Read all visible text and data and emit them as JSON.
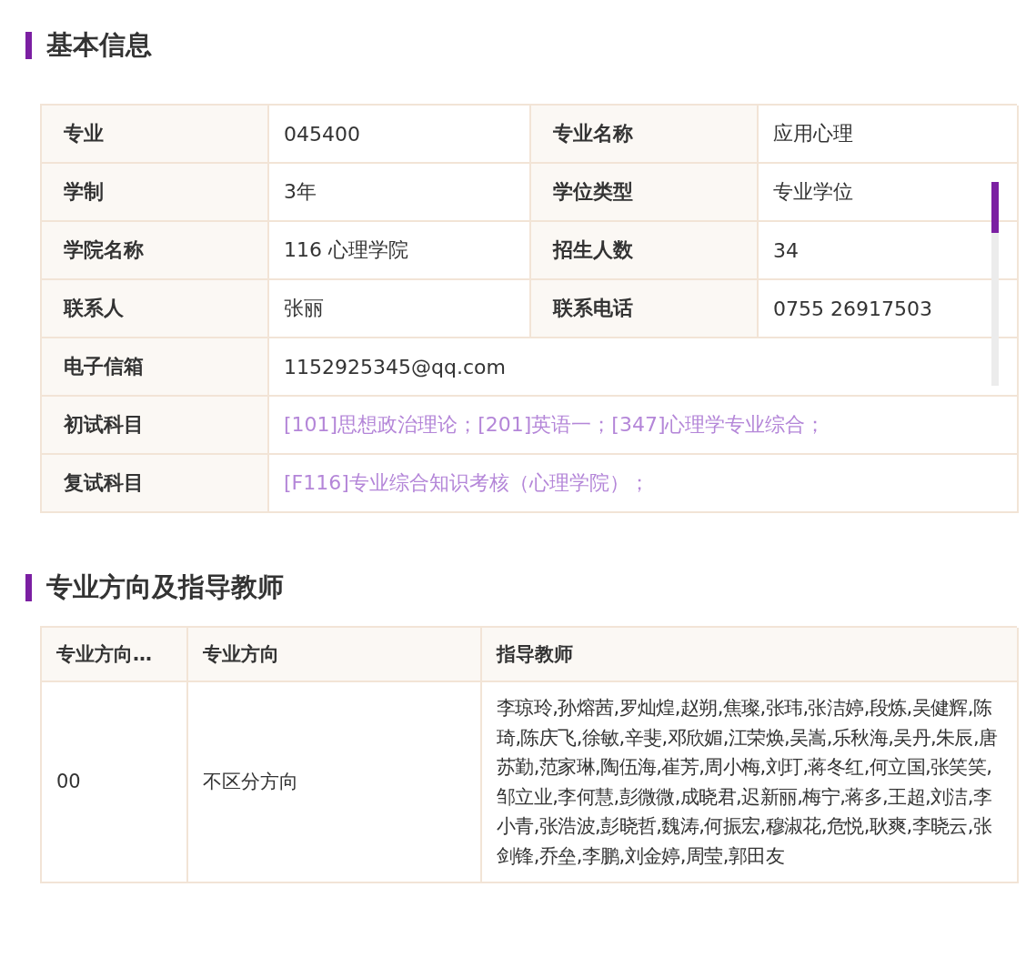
{
  "sections": [
    {
      "title": "基本信息",
      "kind": "info",
      "rows": [
        [
          {
            "kind": "label",
            "text": "专业"
          },
          {
            "kind": "value",
            "text": "045400"
          },
          {
            "kind": "label",
            "text": "专业名称"
          },
          {
            "kind": "value",
            "text": "应用心理"
          }
        ],
        [
          {
            "kind": "label",
            "text": "学制"
          },
          {
            "kind": "value",
            "text": "3年"
          },
          {
            "kind": "label",
            "text": "学位类型"
          },
          {
            "kind": "value",
            "text": "专业学位"
          }
        ],
        [
          {
            "kind": "label",
            "text": "学院名称"
          },
          {
            "kind": "value",
            "text": "116 心理学院"
          },
          {
            "kind": "label",
            "text": "招生人数"
          },
          {
            "kind": "value",
            "text": "34"
          }
        ],
        [
          {
            "kind": "label",
            "text": "联系人"
          },
          {
            "kind": "value",
            "text": "张丽"
          },
          {
            "kind": "label",
            "text": "联系电话"
          },
          {
            "kind": "value",
            "text": "0755 26917503"
          }
        ],
        [
          {
            "kind": "label",
            "text": "电子信箱"
          },
          {
            "kind": "value",
            "text": "1152925345@qq.com"
          }
        ],
        [
          {
            "kind": "label",
            "text": "初试科目"
          },
          {
            "kind": "link",
            "text": "[101]思想政治理论；[201]英语一；[347]心理学专业综合；"
          }
        ],
        [
          {
            "kind": "label",
            "text": "复试科目"
          },
          {
            "kind": "link",
            "text": "[F116]专业综合知识考核（心理学院）；"
          }
        ]
      ]
    },
    {
      "title": "专业方向及指导教师",
      "kind": "grid",
      "columns": [
        "专业方向…",
        "专业方向",
        "指导教师"
      ],
      "rows": [
        [
          "00",
          "不区分方向",
          "李琼玲,孙熔茜,罗灿煌,赵朔,焦璨,张玮,张洁婷,段炼,吴健辉,陈琦,陈庆飞,徐敏,辛斐,邓欣媚,江荣焕,吴嵩,乐秋海,吴丹,朱辰,唐苏勤,范家琳,陶伍海,崔芳,周小梅,刘玎,蒋冬红,何立国,张笑笑,邹立业,李何慧,彭微微,成晓君,迟新丽,梅宁,蒋多,王超,刘洁,李小青,张浩波,彭晓哲,魏涛,何振宏,穆淑花,危悦,耿爽,李晓云,张剑锋,乔垒,李鹏,刘金婷,周莹,郭田友"
        ]
      ]
    }
  ]
}
